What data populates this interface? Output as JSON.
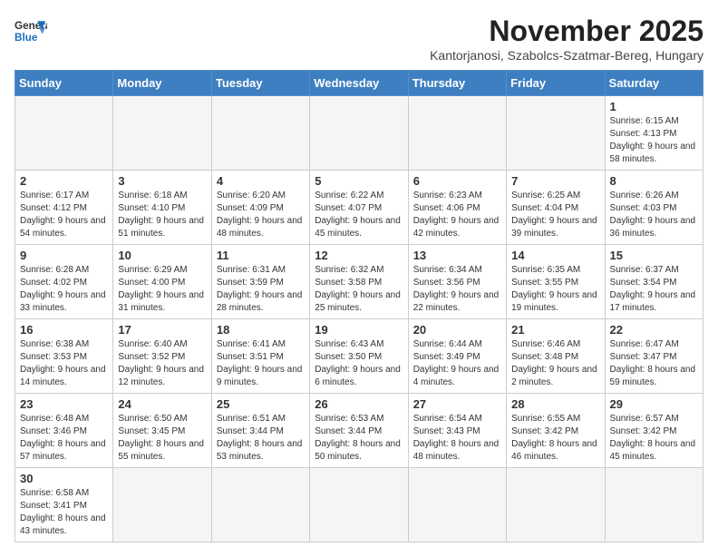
{
  "logo": {
    "line1": "General",
    "line2": "Blue"
  },
  "header": {
    "month": "November 2025",
    "location": "Kantorjanosi, Szabolcs-Szatmar-Bereg, Hungary"
  },
  "weekdays": [
    "Sunday",
    "Monday",
    "Tuesday",
    "Wednesday",
    "Thursday",
    "Friday",
    "Saturday"
  ],
  "weeks": [
    [
      {
        "day": "",
        "info": ""
      },
      {
        "day": "",
        "info": ""
      },
      {
        "day": "",
        "info": ""
      },
      {
        "day": "",
        "info": ""
      },
      {
        "day": "",
        "info": ""
      },
      {
        "day": "",
        "info": ""
      },
      {
        "day": "1",
        "info": "Sunrise: 6:15 AM\nSunset: 4:13 PM\nDaylight: 9 hours and 58 minutes."
      }
    ],
    [
      {
        "day": "2",
        "info": "Sunrise: 6:17 AM\nSunset: 4:12 PM\nDaylight: 9 hours and 54 minutes."
      },
      {
        "day": "3",
        "info": "Sunrise: 6:18 AM\nSunset: 4:10 PM\nDaylight: 9 hours and 51 minutes."
      },
      {
        "day": "4",
        "info": "Sunrise: 6:20 AM\nSunset: 4:09 PM\nDaylight: 9 hours and 48 minutes."
      },
      {
        "day": "5",
        "info": "Sunrise: 6:22 AM\nSunset: 4:07 PM\nDaylight: 9 hours and 45 minutes."
      },
      {
        "day": "6",
        "info": "Sunrise: 6:23 AM\nSunset: 4:06 PM\nDaylight: 9 hours and 42 minutes."
      },
      {
        "day": "7",
        "info": "Sunrise: 6:25 AM\nSunset: 4:04 PM\nDaylight: 9 hours and 39 minutes."
      },
      {
        "day": "8",
        "info": "Sunrise: 6:26 AM\nSunset: 4:03 PM\nDaylight: 9 hours and 36 minutes."
      }
    ],
    [
      {
        "day": "9",
        "info": "Sunrise: 6:28 AM\nSunset: 4:02 PM\nDaylight: 9 hours and 33 minutes."
      },
      {
        "day": "10",
        "info": "Sunrise: 6:29 AM\nSunset: 4:00 PM\nDaylight: 9 hours and 31 minutes."
      },
      {
        "day": "11",
        "info": "Sunrise: 6:31 AM\nSunset: 3:59 PM\nDaylight: 9 hours and 28 minutes."
      },
      {
        "day": "12",
        "info": "Sunrise: 6:32 AM\nSunset: 3:58 PM\nDaylight: 9 hours and 25 minutes."
      },
      {
        "day": "13",
        "info": "Sunrise: 6:34 AM\nSunset: 3:56 PM\nDaylight: 9 hours and 22 minutes."
      },
      {
        "day": "14",
        "info": "Sunrise: 6:35 AM\nSunset: 3:55 PM\nDaylight: 9 hours and 19 minutes."
      },
      {
        "day": "15",
        "info": "Sunrise: 6:37 AM\nSunset: 3:54 PM\nDaylight: 9 hours and 17 minutes."
      }
    ],
    [
      {
        "day": "16",
        "info": "Sunrise: 6:38 AM\nSunset: 3:53 PM\nDaylight: 9 hours and 14 minutes."
      },
      {
        "day": "17",
        "info": "Sunrise: 6:40 AM\nSunset: 3:52 PM\nDaylight: 9 hours and 12 minutes."
      },
      {
        "day": "18",
        "info": "Sunrise: 6:41 AM\nSunset: 3:51 PM\nDaylight: 9 hours and 9 minutes."
      },
      {
        "day": "19",
        "info": "Sunrise: 6:43 AM\nSunset: 3:50 PM\nDaylight: 9 hours and 6 minutes."
      },
      {
        "day": "20",
        "info": "Sunrise: 6:44 AM\nSunset: 3:49 PM\nDaylight: 9 hours and 4 minutes."
      },
      {
        "day": "21",
        "info": "Sunrise: 6:46 AM\nSunset: 3:48 PM\nDaylight: 9 hours and 2 minutes."
      },
      {
        "day": "22",
        "info": "Sunrise: 6:47 AM\nSunset: 3:47 PM\nDaylight: 8 hours and 59 minutes."
      }
    ],
    [
      {
        "day": "23",
        "info": "Sunrise: 6:48 AM\nSunset: 3:46 PM\nDaylight: 8 hours and 57 minutes."
      },
      {
        "day": "24",
        "info": "Sunrise: 6:50 AM\nSunset: 3:45 PM\nDaylight: 8 hours and 55 minutes."
      },
      {
        "day": "25",
        "info": "Sunrise: 6:51 AM\nSunset: 3:44 PM\nDaylight: 8 hours and 53 minutes."
      },
      {
        "day": "26",
        "info": "Sunrise: 6:53 AM\nSunset: 3:44 PM\nDaylight: 8 hours and 50 minutes."
      },
      {
        "day": "27",
        "info": "Sunrise: 6:54 AM\nSunset: 3:43 PM\nDaylight: 8 hours and 48 minutes."
      },
      {
        "day": "28",
        "info": "Sunrise: 6:55 AM\nSunset: 3:42 PM\nDaylight: 8 hours and 46 minutes."
      },
      {
        "day": "29",
        "info": "Sunrise: 6:57 AM\nSunset: 3:42 PM\nDaylight: 8 hours and 45 minutes."
      }
    ],
    [
      {
        "day": "30",
        "info": "Sunrise: 6:58 AM\nSunset: 3:41 PM\nDaylight: 8 hours and 43 minutes."
      },
      {
        "day": "",
        "info": ""
      },
      {
        "day": "",
        "info": ""
      },
      {
        "day": "",
        "info": ""
      },
      {
        "day": "",
        "info": ""
      },
      {
        "day": "",
        "info": ""
      },
      {
        "day": "",
        "info": ""
      }
    ]
  ]
}
